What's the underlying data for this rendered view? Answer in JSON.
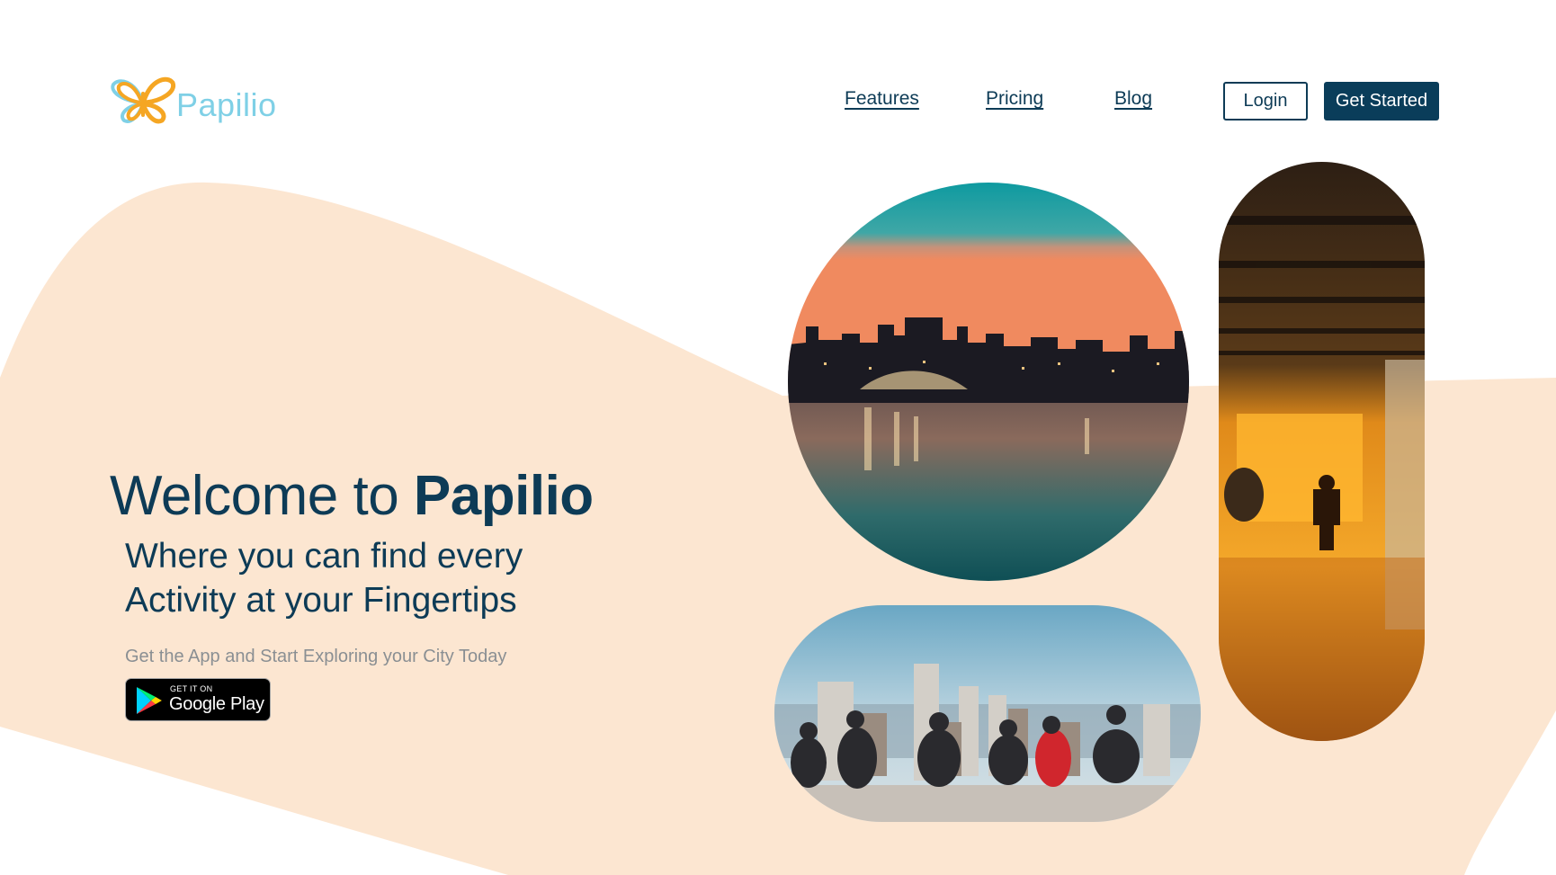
{
  "brand": {
    "name": "Papilio",
    "logo_icon": "butterfly-icon"
  },
  "nav": {
    "links": [
      "Features",
      "Pricing",
      "Blog"
    ],
    "login_label": "Login",
    "get_started_label": "Get Started"
  },
  "hero": {
    "title_prefix": "Welcome to ",
    "title_brand": "Papilio",
    "subtitle_line1": "Where you can find every",
    "subtitle_line2": "Activity at your Fingertips",
    "tagline": "Get the App and Start Exploring your City Today",
    "store_badge": {
      "small_text": "GET IT ON",
      "store_name": "Google Play",
      "icon": "google-play-icon"
    }
  },
  "colors": {
    "navy": "#0a3d5a",
    "peach": "#fce6d1",
    "logo_orange": "#f5a623",
    "logo_cyan": "#7fd0e6",
    "muted_text": "#8a8f93"
  }
}
